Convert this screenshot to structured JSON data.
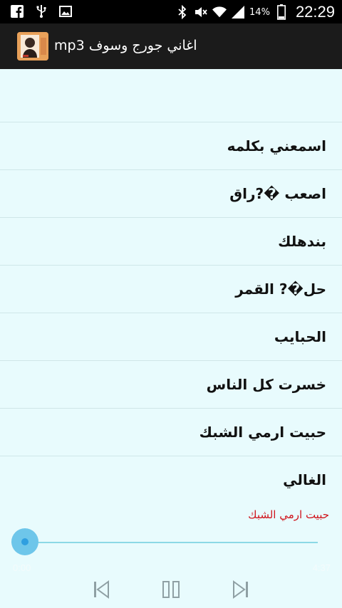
{
  "status_bar": {
    "battery_percent": "14%",
    "time": "22:29",
    "icons": [
      "facebook-icon",
      "usb-icon",
      "image-icon",
      "bluetooth-icon",
      "mute-icon",
      "wifi-icon",
      "signal-icon",
      "battery-icon"
    ]
  },
  "action_bar": {
    "title": "اغاني جورج وسوف mp3",
    "icon": "app-icon"
  },
  "songs": [
    {
      "label": "اسمعني بكلمه"
    },
    {
      "label": "اصعب �?راق"
    },
    {
      "label": "بندهلك"
    },
    {
      "label": "حل�? القمر"
    },
    {
      "label": "الحبايب"
    },
    {
      "label": "خسرت كل الناس"
    },
    {
      "label": "حبيت ارمي الشبك"
    },
    {
      "label": "الغالي"
    }
  ],
  "player": {
    "now_playing": "حبيت ارمي الشبك",
    "elapsed": "0:00",
    "total": "4:37",
    "progress": 0.0,
    "controls": [
      "previous-icon",
      "pause-icon",
      "next-icon"
    ]
  },
  "colors": {
    "background": "#e8fbfd",
    "action_bar": "#1b1b1b",
    "now_playing_text": "#d0131b",
    "seek_thumb": "#6ec6ea"
  }
}
